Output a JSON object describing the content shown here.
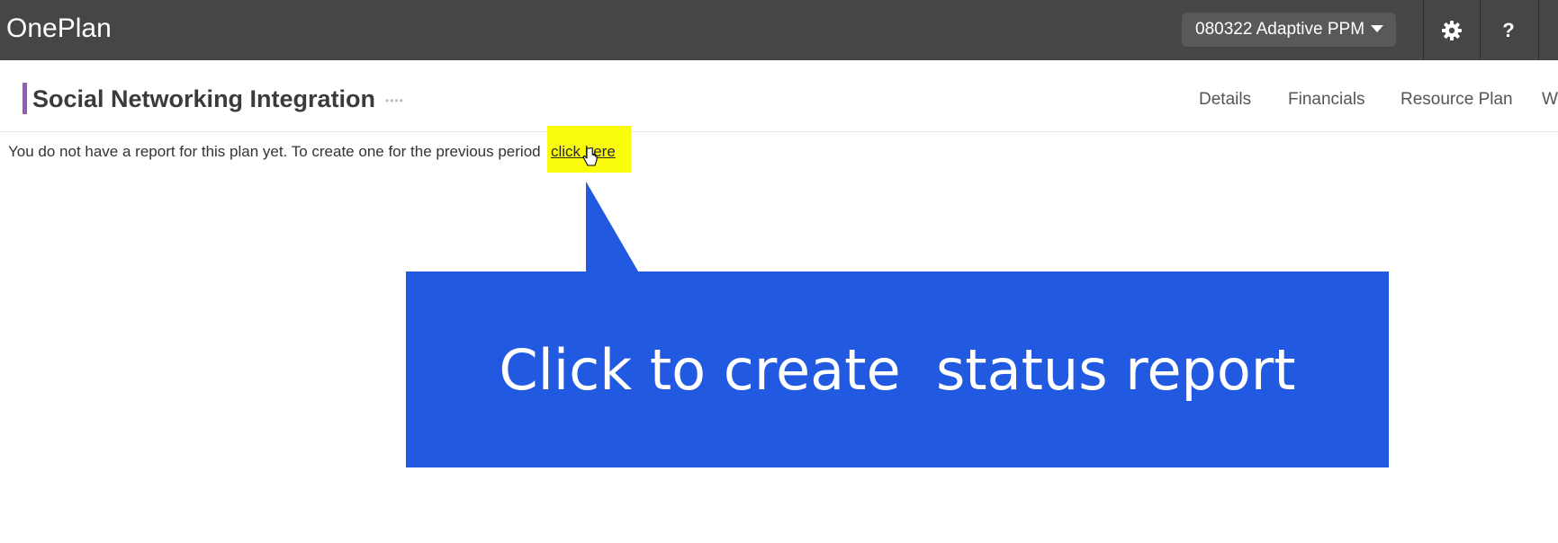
{
  "app": {
    "title": "OnePlan"
  },
  "topbar": {
    "workspace_label": "080322 Adaptive PPM",
    "settings_icon": "gear-icon",
    "help_icon": "question-icon",
    "help_glyph": "?"
  },
  "plan": {
    "title": "Social Networking Integration",
    "more_glyph": "••••",
    "accent_color": "#8e5fb5"
  },
  "tabs": [
    {
      "label": "Details"
    },
    {
      "label": "Financials"
    },
    {
      "label": "Resource Plan"
    },
    {
      "label": "W"
    }
  ],
  "status_report": {
    "message": "You do not have a report for this plan yet. To create one for the previous period",
    "link_label": "click here"
  },
  "callout": {
    "text": "Click to create  status report",
    "color": "#2159e0",
    "highlight_color": "#fbfb0c"
  }
}
